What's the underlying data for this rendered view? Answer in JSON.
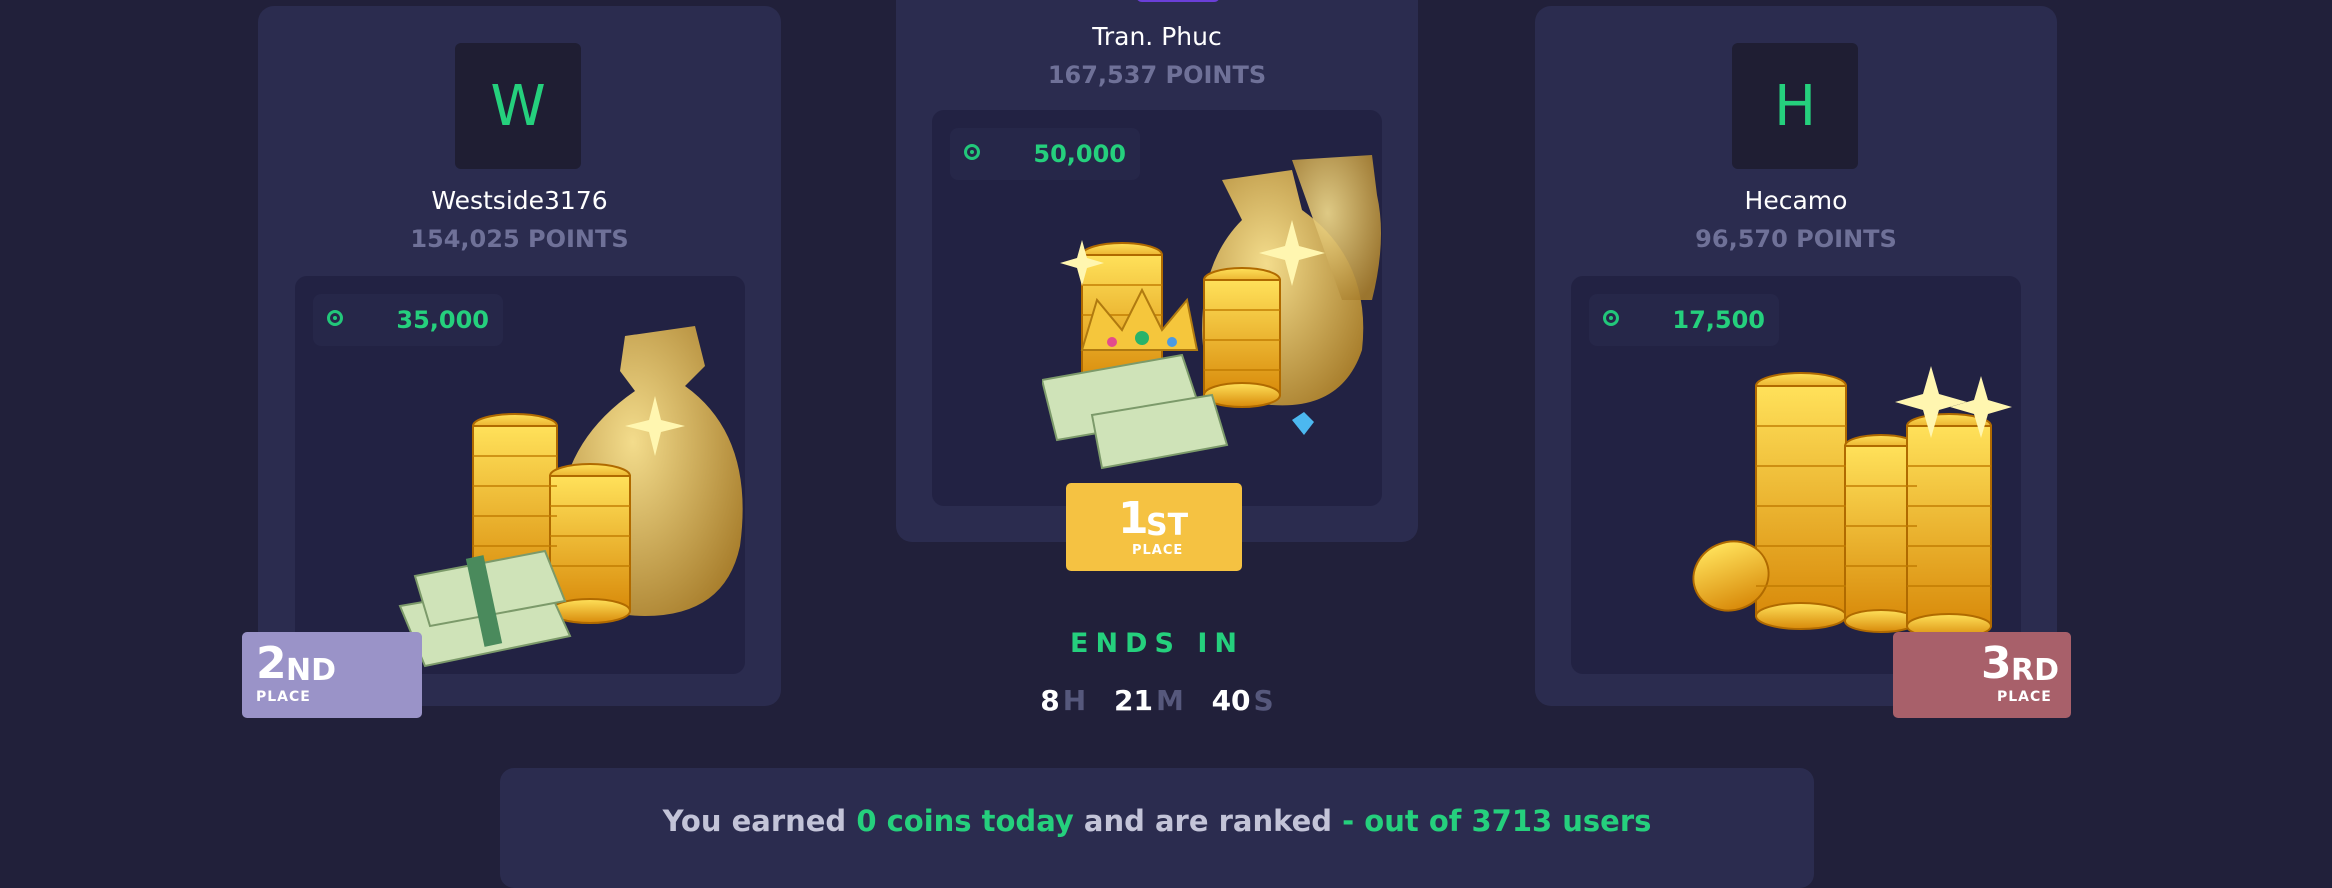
{
  "podium": {
    "first": {
      "username": "Tran. Phuc",
      "points": "167,537 POINTS",
      "prize": "50,000",
      "rank_number": "1",
      "rank_suffix": "ST",
      "place_label": "PLACE",
      "badge_color": "#f5c242",
      "icon": "coin-icon"
    },
    "second": {
      "avatar_letter": "W",
      "username": "Westside3176",
      "points": "154,025 POINTS",
      "prize": "35,000",
      "rank_number": "2",
      "rank_suffix": "ND",
      "place_label": "PLACE",
      "badge_color": "#9a93c8",
      "icon": "coin-icon"
    },
    "third": {
      "avatar_letter": "H",
      "username": "Hecamo",
      "points": "96,570 POINTS",
      "prize": "17,500",
      "rank_number": "3",
      "rank_suffix": "RD",
      "place_label": "PLACE",
      "badge_color": "#a8606a",
      "icon": "coin-icon"
    }
  },
  "countdown": {
    "label": "ENDS IN",
    "hours": "8",
    "hours_unit": "H",
    "minutes": "21",
    "minutes_unit": "M",
    "seconds": "40",
    "seconds_unit": "S"
  },
  "summary": {
    "prefix": "You earned",
    "coins_today": "0 coins today",
    "middle": "and are ranked",
    "rank_text": "- out of 3713 users"
  },
  "colors": {
    "background": "#21203a",
    "card": "#2b2c4f",
    "accent_green": "#25d07d",
    "muted": "#6f7198"
  }
}
